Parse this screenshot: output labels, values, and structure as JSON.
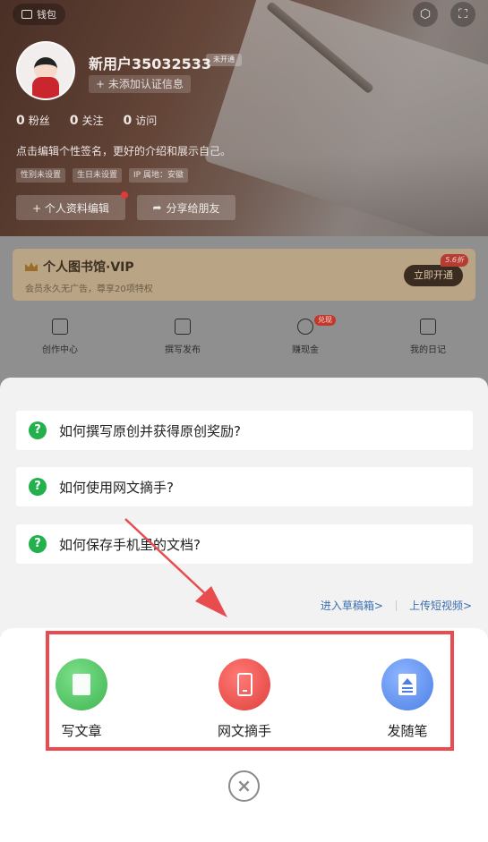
{
  "header": {
    "wallet_label": "钱包",
    "username": "新用户35032533",
    "v_badge": "未开通",
    "cert_label": "+ 未添加认证信息",
    "stats": [
      {
        "count": "0",
        "label": "粉丝"
      },
      {
        "count": "0",
        "label": "关注"
      },
      {
        "count": "0",
        "label": "访问"
      }
    ],
    "bio": "点击编辑个性签名，更好的介绍和展示自己。",
    "tags": [
      "性别未设置",
      "生日未设置",
      "IP 属地：安徽"
    ],
    "edit_profile": "+ 个人资料编辑",
    "share": "分享给朋友"
  },
  "vip": {
    "title": "个人图书馆·VIP",
    "subtitle": "会员永久无广告，尊享20项特权",
    "button": "立即开通",
    "discount": "5.6折"
  },
  "quick_actions": [
    {
      "label": "创作中心"
    },
    {
      "label": "撰写发布"
    },
    {
      "label": "赚现金",
      "badge": "兑现"
    },
    {
      "label": "我的日记"
    }
  ],
  "sheet": {
    "faqs": [
      "如何撰写原创并获得原创奖励?",
      "如何使用网文摘手?",
      "如何保存手机里的文档?"
    ],
    "link_drafts": "进入草稿箱>",
    "link_video": "上传短视频>",
    "actions": [
      {
        "label": "写文章",
        "icon": "document-icon",
        "color": "#3fb552"
      },
      {
        "label": "网文摘手",
        "icon": "phone-icon",
        "color": "#e0403c"
      },
      {
        "label": "发随笔",
        "icon": "note-icon",
        "color": "#4c7fe6"
      }
    ],
    "close_symbol": "×"
  },
  "colors": {
    "highlight": "#e84c4f",
    "arrow": "#e84c4f",
    "faq_icon": "#22b14c",
    "link": "#3a6fb0"
  }
}
